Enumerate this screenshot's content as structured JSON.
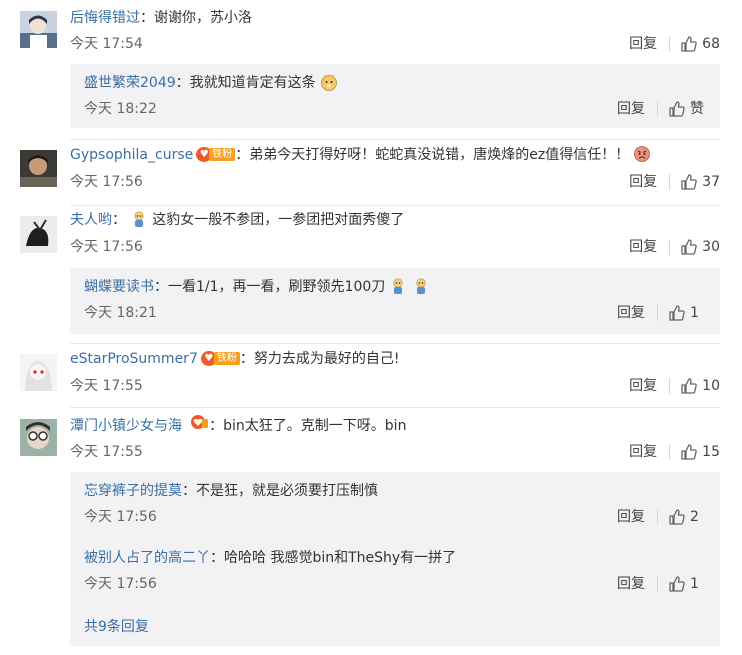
{
  "actions": {
    "reply": "回复",
    "like_icon": "thumbs-up-icon"
  },
  "comments": [
    {
      "user": "后悔得错过",
      "text": "：谢谢你，苏小洛",
      "time": "今天 17:54",
      "likes": "68"
    },
    {
      "user": "Gypsophila_curse",
      "badge": "铁粉",
      "text": "：弟弟今天打得好呀！蛇蛇真没说错，唐焕烽的ez值得信任！！",
      "time": "今天 17:56",
      "likes": "37"
    },
    {
      "user": "夫人哟",
      "text": "：",
      "text2": "这豹女一般不参团，一参团把对面秀傻了",
      "time": "今天 17:56",
      "likes": "30"
    },
    {
      "user": "eStarProSummer7",
      "badge": "铁粉",
      "text": "：努力去成为最好的自己!",
      "time": "今天 17:55",
      "likes": "10"
    },
    {
      "user": "潭门小镇少女与海",
      "text": "：bin太狂了。克制一下呀。bin",
      "time": "今天 17:55",
      "likes": "15"
    }
  ],
  "replies": {
    "r1": {
      "user": "盛世繁荣2049",
      "text": "：我就知道肯定有这条",
      "time": "今天 18:22",
      "likes": "赞"
    },
    "r2": {
      "user": "蝴蝶要读书",
      "text": "：一看1/1，再一看，刷野领先100刀",
      "time": "今天 18:21",
      "likes": "1"
    },
    "r3": {
      "user": "忘穿裤子的提莫",
      "text": "：不是狂，就是必须要打压制慎",
      "time": "今天 17:56",
      "likes": "2"
    },
    "r4": {
      "user": "被别人占了的高二丫",
      "text": "：哈哈哈 我感觉bin和TheShy有一拼了",
      "time": "今天 17:56",
      "likes": "1"
    }
  },
  "more_replies": "共9条回复"
}
